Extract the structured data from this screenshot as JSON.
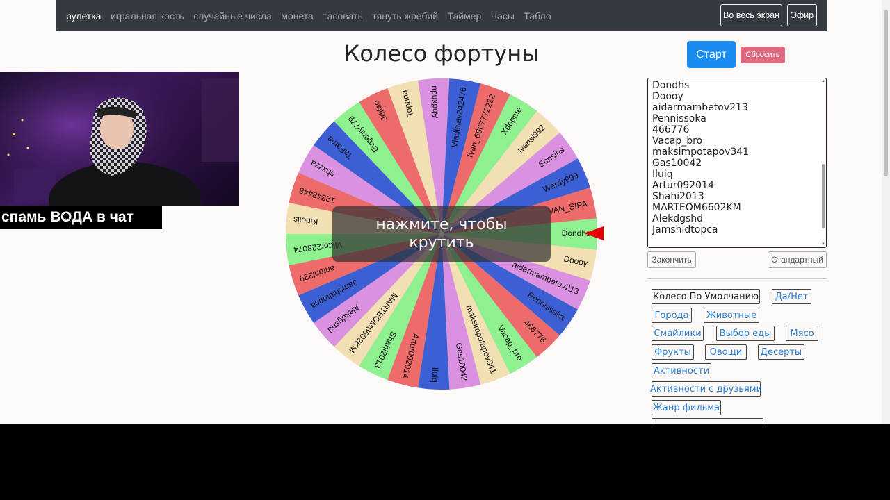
{
  "navbar": {
    "links": [
      "рулетка",
      "игральная кость",
      "случайные числа",
      "монета",
      "тасовать",
      "тянуть жребий",
      "Таймер",
      "Часы",
      "Табло"
    ],
    "fullscreen_label": "Во весь экран",
    "live_label": "Эфир"
  },
  "title": "Колесо фортуны",
  "controls": {
    "start_label": "Старт",
    "reset_label": "Сбросить",
    "finish_label": "Закончить",
    "standard_label": "Стандартный"
  },
  "names": [
    "Dondhs",
    "Doooy",
    "aidarmambetov213",
    "Pennissoka",
    "466776",
    "Vacap_bro",
    "maksimpotapov341",
    "Gas10042",
    "Iluiq",
    "Artur092014",
    "Shahi2013",
    "MARTEOM6602KM",
    "Alekdgshd",
    "Jamshidtopca"
  ],
  "presets": [
    "Колесо По Умолчанию",
    "Да/Нет",
    "Города",
    "Животные",
    "Смайлики",
    "Выбор еды",
    "Мясо",
    "Фрукты",
    "Овощи",
    "Десерты",
    "Активности",
    "Активности с друзьями",
    "Жанр фильма"
  ],
  "wheel": {
    "overlay_text_line1": "нажмите, чтобы",
    "overlay_text_line2": "крутить",
    "colors": [
      "#8ef08e",
      "#f2dfb4",
      "#d991e0",
      "#3c5fd4",
      "#ee6b6b"
    ],
    "segments": [
      "Dondhs",
      "Doooy",
      "aidarmambetov213",
      "Pennissoka",
      "466776",
      "Vacap_bro",
      "maksimpotapov341",
      "Gas10042",
      "Iluiq",
      "Artur092014",
      "Shahi2013",
      "MARTEOM6602KM",
      "Alekdgshd",
      "Jamshidtopca",
      "antonl229",
      "Viktor228074",
      "Kiriolis",
      "12348448",
      "shxzza",
      "TaFama",
      "Evgeniy779",
      "Jdjfso",
      "Topnna",
      "Abdxhdu",
      "Vladislav242476",
      "Ivan_6667772222",
      "Xdopme",
      "Ivansi992",
      "Scnsihs",
      "Werdy999",
      "VAN_SIPA"
    ],
    "segment_colors": [
      0,
      1,
      2,
      3,
      4,
      0,
      1,
      2,
      3,
      4,
      0,
      1,
      2,
      3,
      4,
      0,
      1,
      4,
      2,
      3,
      0,
      4,
      1,
      2,
      3,
      4,
      0,
      1,
      2,
      3,
      4
    ]
  },
  "webcam": {
    "caption": "спамь ВОДА в чат"
  }
}
